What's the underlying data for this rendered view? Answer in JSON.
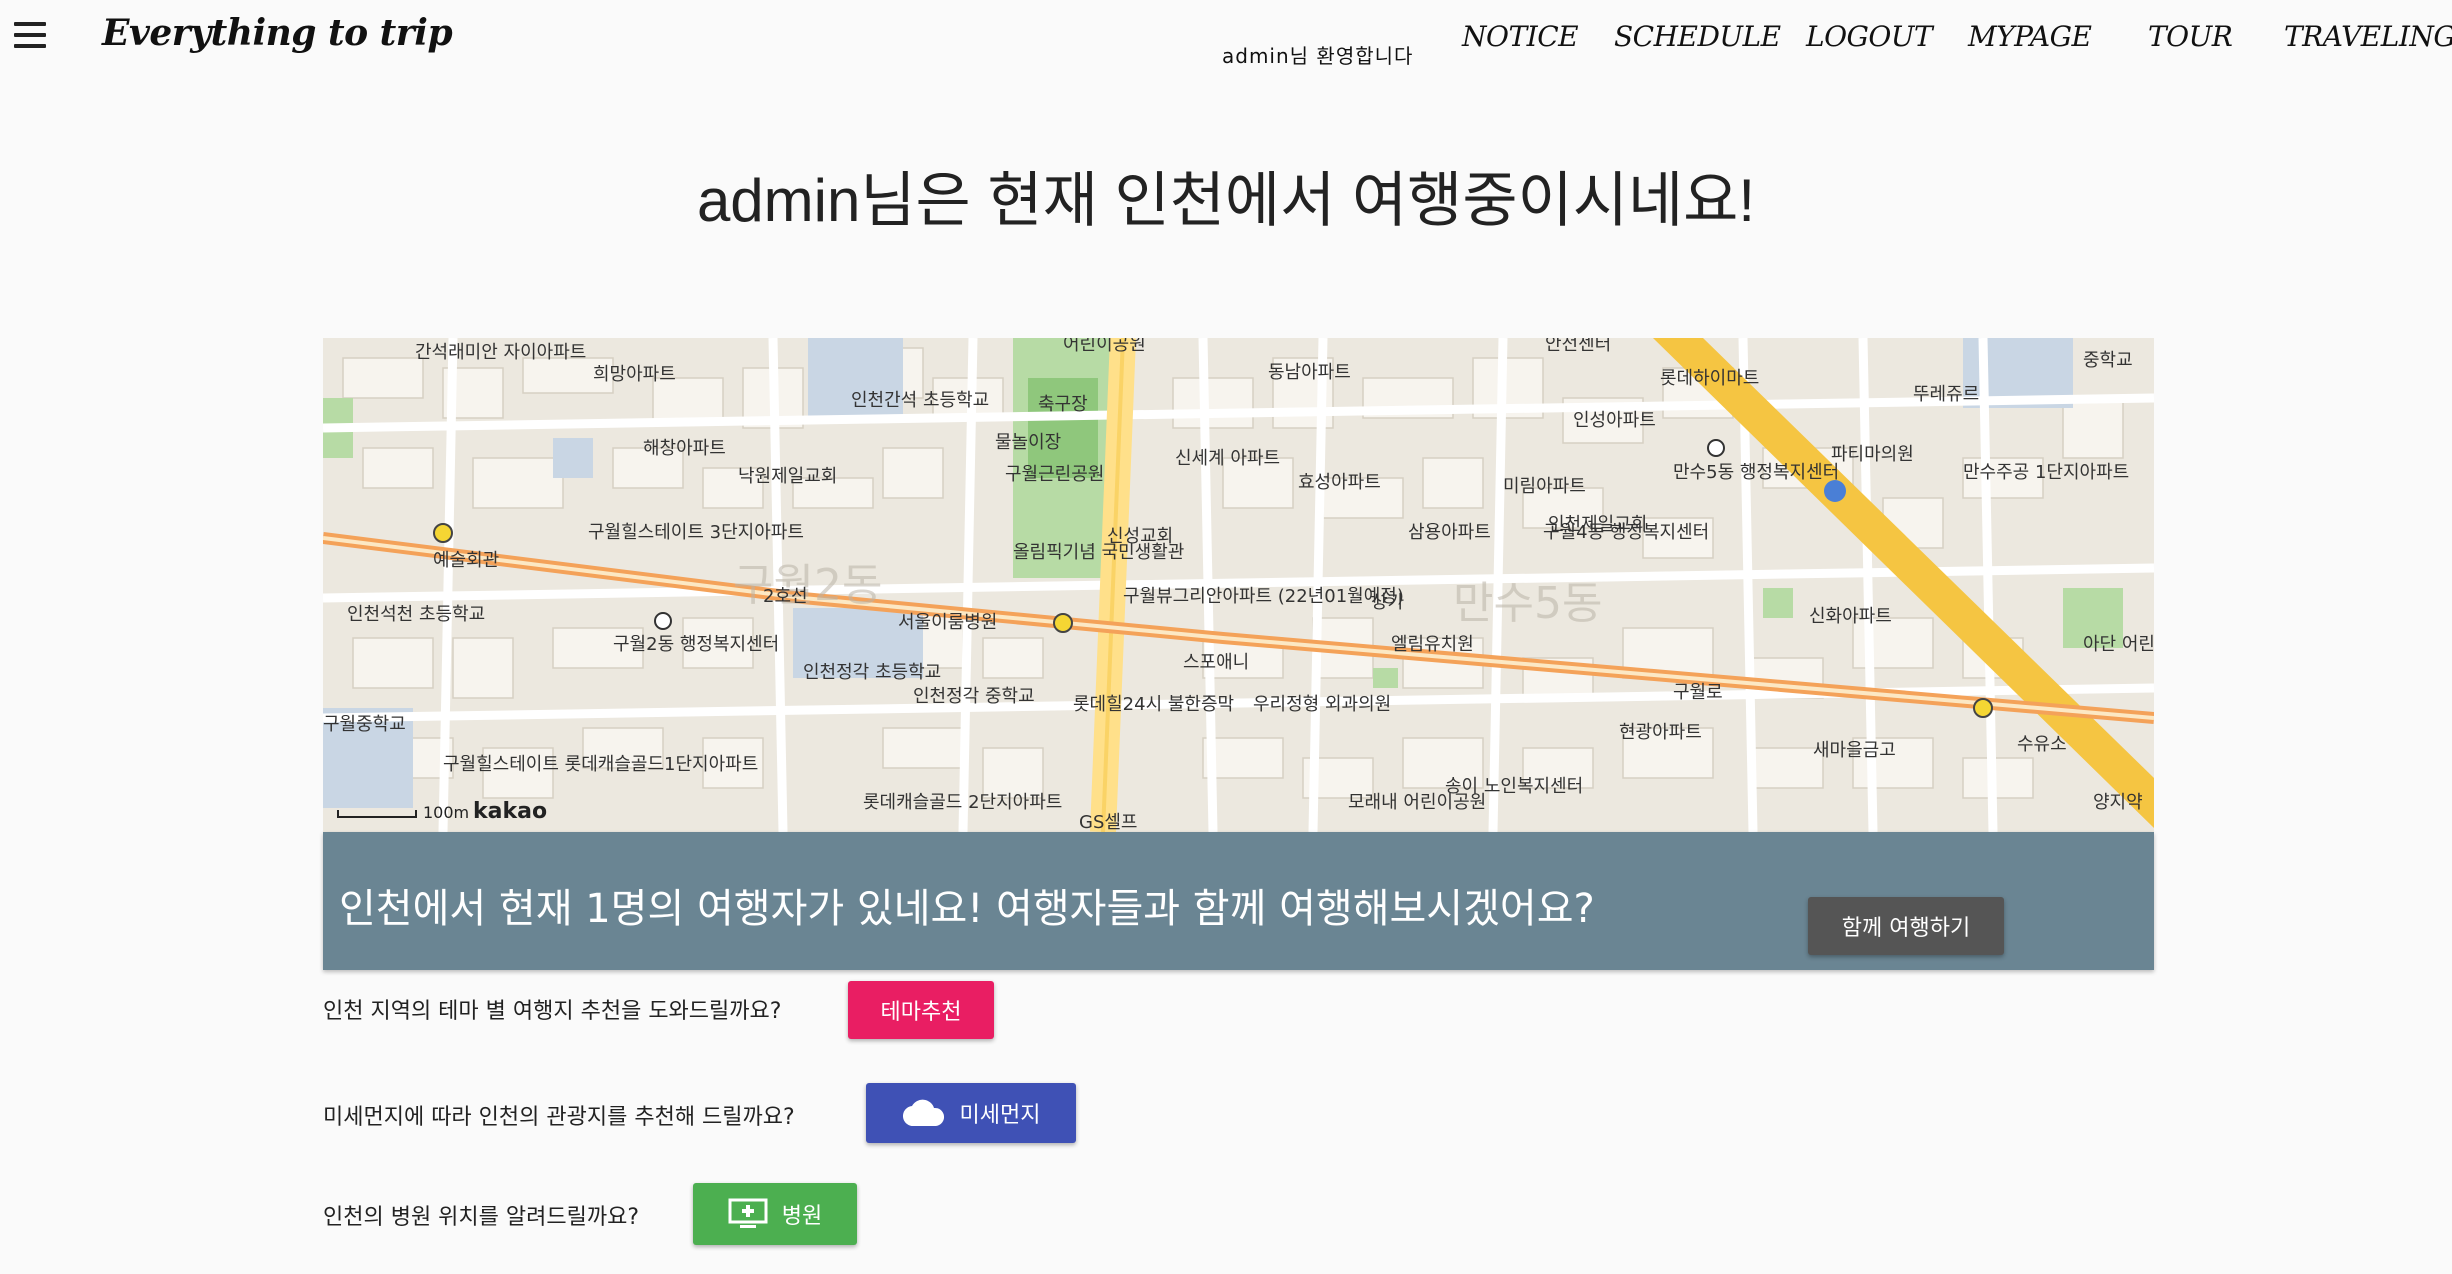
{
  "nav": {
    "brand": "Everything to trip",
    "welcome": "admin님 환영합니다",
    "links": [
      "NOTICE",
      "SCHEDULE",
      "LOGOUT",
      "MYPAGE",
      "TOUR",
      "TRAVELING"
    ]
  },
  "heading": "admin님은 현재 인천에서 여행중이시네요!",
  "map": {
    "labels": [
      "간석래미안 자이아파트",
      "희망아파트",
      "인천간석 초등학교",
      "어린이공원",
      "축구장",
      "물놀이장",
      "구월근린공원",
      "동남아파트",
      "안전센터",
      "롯데하이마트",
      "뚜레쥬르",
      "중학교",
      "해창아파트",
      "낙원제일교회",
      "신세계 아파트",
      "효성아파트",
      "미림아파트",
      "인성아파트",
      "만수5동 행정복지센터",
      "파티마의원",
      "만수주공 1단지아파트",
      "구월힐스테이트 3단지아파트",
      "구월4동 행정복지센터",
      "신성교회",
      "올림픽기념 국민생활관",
      "삼용아파트",
      "인천제일교회",
      "인천석천 초등학교",
      "구월2동 행정복지센터",
      "서울이룸병원",
      "구월뷰그리안아파트 (22년01월예정)",
      "상가",
      "엘림유치원",
      "신화아파트",
      "아단 어린이공원",
      "인천정각 초등학교",
      "인천정각 중학교",
      "스포애니",
      "롯데힐24시 불한증막",
      "우리정형 외과의원",
      "구월중학교",
      "현광아파트",
      "새마을금고",
      "수유소",
      "구월힐스테이트 롯데캐슬골드1단지아파트",
      "롯데캐슬골드 2단지아파트",
      "모래내 어린이공원",
      "송이 노인복지센터",
      "양지약",
      "GS셀프",
      "구월2동",
      "만수5동",
      "예술회관",
      "2호선",
      "구월로"
    ],
    "scale": "100m",
    "logo": "kakao"
  },
  "banner": {
    "text": "인천에서 현재 1명의 여행자가 있네요! 여행자들과 함께 여행해보시겠어요?",
    "button": "함께 여행하기"
  },
  "suggestions": [
    {
      "text": "인천 지역의 테마 별 여행지 추천을 도와드릴까요?",
      "button": "테마추천",
      "color": "#e91e63"
    },
    {
      "text": "미세먼지에 따라 인천의 관광지를 추천해 드릴까요?",
      "button": "미세먼지",
      "color": "#3f51b5",
      "icon": "cloud-icon"
    },
    {
      "text": "인천의 병원 위치를 알려드릴까요?",
      "button": "병원",
      "color": "#4caf50",
      "icon": "add-to-queue-icon"
    }
  ]
}
